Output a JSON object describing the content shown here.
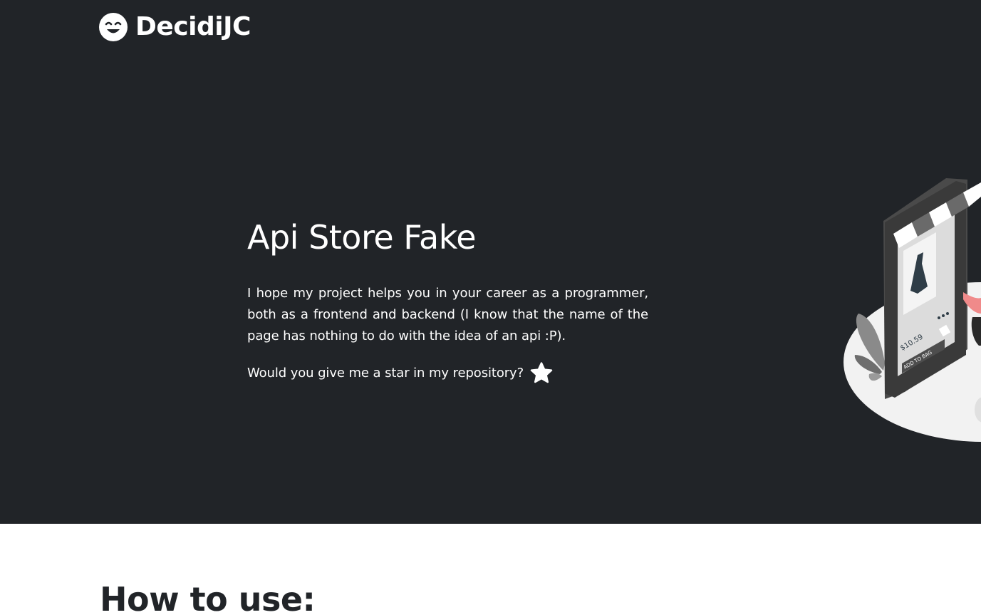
{
  "header": {
    "brand_name": "DecidiJC",
    "logo_icon": "smiling-face-icon"
  },
  "hero": {
    "title": "Api Store Fake",
    "description": "I hope my project helps you in your career as a programmer, both as a frontend and backend (I know that the name of the page has nothing to do with the idea of an api :P).",
    "star_prompt": "Would you give me a star in my repository?",
    "star_icon": "star-icon",
    "illustration": {
      "name": "online-shopping-phone-illustration",
      "price_text": "$10.59",
      "button_text": "ADD TO BAG"
    }
  },
  "how_to_use": {
    "title": "How to use:"
  },
  "colors": {
    "hero_background": "#212428",
    "text_light": "#ffffff",
    "page_background": "#ffffff",
    "text_dark": "#212428"
  }
}
